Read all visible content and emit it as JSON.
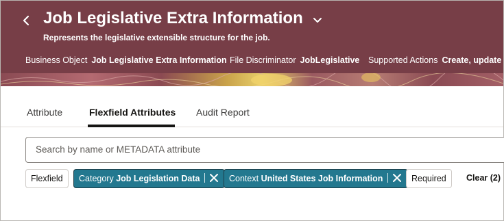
{
  "header": {
    "title": "Job Legislative Extra Information",
    "subtitle": "Represents the legislative extensible structure for the job.",
    "meta": [
      {
        "label": "Business Object",
        "value": "Job Legislative Extra Information"
      },
      {
        "label": "File Discriminator",
        "value": "JobLegislative"
      },
      {
        "label": "Supported Actions",
        "value": "Create, update a"
      }
    ]
  },
  "tabs": [
    {
      "label": "Attribute",
      "active": false
    },
    {
      "label": "Flexfield Attributes",
      "active": true
    },
    {
      "label": "Audit Report",
      "active": false
    }
  ],
  "search": {
    "placeholder": "Search by name or METADATA attribute"
  },
  "filters": {
    "flexfield_label": "Flexfield",
    "category": {
      "label": "Category",
      "value": "Job Legislation Data"
    },
    "context": {
      "label": "Context",
      "value": "United States Job Information"
    },
    "required_label": "Required",
    "clear_label": "Clear (2)"
  },
  "colors": {
    "header_bg": "#773e47",
    "filter_chip_bg": "#23788f"
  },
  "icons": {
    "back": "chevron-left-icon",
    "title_menu": "chevron-down-icon",
    "remove_filter": "close-icon"
  }
}
